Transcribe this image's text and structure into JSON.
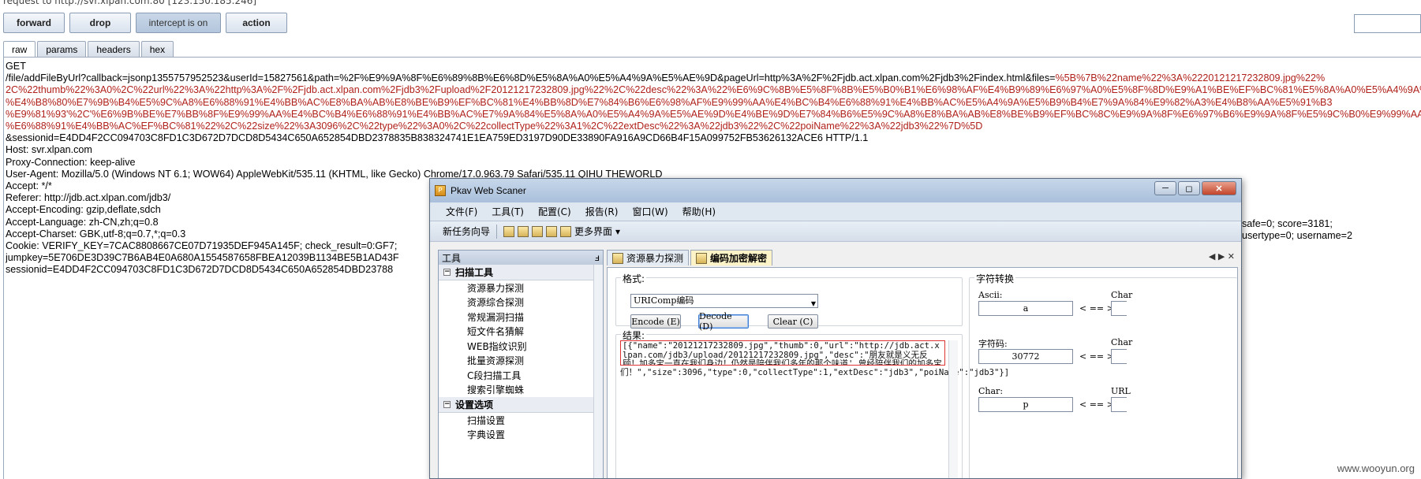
{
  "top_line": "request to http://svr.xlpan.com:80  [123.150.185.246]",
  "toolbar": {
    "forward": "forward",
    "drop": "drop",
    "intercept": "intercept is on",
    "action": "action"
  },
  "tabs": [
    "raw",
    "params",
    "headers",
    "hex"
  ],
  "request": {
    "lines": [
      {
        "text": "GET",
        "hl": ""
      },
      {
        "text": "/file/addFileByUrl?callback=jsonp1355757952523&userId=15827561&path=%2F%E9%9A%8F%E6%89%8B%E6%8D%E5%8A%A0%E5%A4%9A%E5%AE%9D&pageUrl=http%3A%2F%2Fjdb.act.xlpan.com%2Fjdb3%2Findex.html&files=",
        "hl": "%5B%7B%22name%22%3A%2220121217232809.jpg%22%"
      },
      {
        "text": "",
        "hl": "2C%22thumb%22%3A0%2C%22url%22%3A%22http%3A%2F%2Fjdb.act.xlpan.com%2Fjdb3%2Fupload%2F20121217232809.jpg%22%2C%22desc%22%3A%22%E6%9C%8B%E5%8F%8B%E5%B0%B1%E6%98%AF%E4%B9%89%E6%97%A0%E5%8F%8D%E9%A1%BE%EF%BC%81%E5%8A%A0%E5%A4%9A%E5%AE%9D"
      },
      {
        "text": "",
        "hl": "%E4%B8%80%E7%9B%B4%E5%9C%A8%E6%88%91%E4%BB%AC%E8%BA%AB%E8%BE%B9%EF%BC%81%E4%BB%8D%E7%84%B6%E6%98%AF%E9%99%AA%E4%BC%B4%E6%88%91%E4%BB%AC%E5%A4%9A%E5%B9%B4%E7%9A%84%E9%82%A3%E4%B8%AA%E5%91%B3"
      },
      {
        "text": "",
        "hl": "%E9%81%93'%2C'%E6%9B%BE%E7%BB%8F%E9%99%AA%E4%BC%B4%E6%88%91%E4%BB%AC%E7%9A%84%E5%8A%A0%E5%A4%9A%E5%AE%9D%E4%BE%9D%E7%84%B6%E5%9C%A8%E8%BA%AB%E8%BE%B9%EF%BC%8C%E9%9A%8F%E6%97%B6%E9%9A%8F%E5%9C%B0%E9%99%AA%E4%BC%B4"
      },
      {
        "text": "",
        "hl": "%E6%88%91%E4%BB%AC%EF%BC%81%22%2C%22size%22%3A3096%2C%22type%22%3A0%2C%22collectType%22%3A1%2C%22extDesc%22%3A%22jdb3%22%2C%22poiName%22%3A%22jdb3%22%7D%5D"
      },
      {
        "text": "&sessionid=E4DD4F2CC094703C8FD1C3D672D7DCD8D5434C650A652854DBD2378835B838324741E1EA759ED3197D90DE33890FA916A9CD66B4F15A099752FB53626132ACE6 HTTP/1.1",
        "hl": ""
      },
      {
        "text": "Host: svr.xlpan.com",
        "hl": ""
      },
      {
        "text": "Proxy-Connection: keep-alive",
        "hl": ""
      },
      {
        "text": "User-Agent: Mozilla/5.0 (Windows NT 6.1; WOW64) AppleWebKit/535.11 (KHTML, like Gecko) Chrome/17.0.963.79 Safari/535.11 QIHU THEWORLD",
        "hl": ""
      },
      {
        "text": "Accept: */*",
        "hl": ""
      },
      {
        "text": "Referer: http://jdb.act.xlpan.com/jdb3/",
        "hl": ""
      },
      {
        "text": "Accept-Encoding: gzip,deflate,sdch",
        "hl": ""
      },
      {
        "text": "Accept-Language: zh-CN,zh;q=0.8",
        "hl": ""
      },
      {
        "text": "Accept-Charset: GBK,utf-8;q=0.7,*;q=0.3",
        "hl": ""
      },
      {
        "text": "Cookie: VERIFY_KEY=7CAC8808667CE07D71935DEF945A145F; check_result=0:GF7;",
        "hl": ""
      },
      {
        "text": "jumpkey=5E706DE3D39C7B6AB4E0A680A1554587658FBEA12039B1134BE5B1AD43F",
        "hl": ""
      },
      {
        "text": "sessionid=E4DD4F2CC094703C8FD1C3D672D7DCD8D5434C650A652854DBD23788",
        "hl": ""
      }
    ],
    "right_frag_1": "safe=0; score=3181;",
    "right_frag_2": "usertype=0; username=2"
  },
  "window": {
    "title": "Pkav Web Scaner",
    "controls": {
      "minimize": "─",
      "restore": "◻",
      "close": "✕"
    },
    "menu": [
      "文件(F)",
      "工具(T)",
      "配置(C)",
      "报告(R)",
      "窗口(W)",
      "帮助(H)"
    ],
    "toolbar": {
      "new_task": "新任务向导",
      "more": "更多界面"
    },
    "left_pane": {
      "title": "工具",
      "pin": "ⅎ",
      "group1": "扫描工具",
      "group1_items": [
        "资源暴力探测",
        "资源综合探测",
        "常规漏洞扫描",
        "短文件名猜解",
        "WEB指纹识别",
        "批量资源探测",
        "C段扫描工具",
        "搜索引擎蜘蛛"
      ],
      "group2": "设置选项",
      "group2_items": [
        "扫描设置",
        "字典设置"
      ]
    },
    "doc_tabs": [
      "资源暴力探测",
      "编码加密解密"
    ],
    "tab_nav": "◀ ▶ ✕",
    "format_label": "格式:",
    "format_value": "URIComp编码",
    "buttons": {
      "encode": "Encode (E)",
      "decode": "Decode (D)",
      "clear": "Clear (C)"
    },
    "result_label": "结果:",
    "result_text": "[{\"name\":\"20121217232809.jpg\",\"thumb\":0,\"url\":\"http://jdb.act.xlpan.com/jdb3/upload/20121217232809.jpg\",\"desc\":\"朋友就是义无反顾！加多宝一直在我们身边！仍然是陪伴我们多年的那个味道',曾经陪伴我们的加多宝依然在身边，随时随地陪伴我",
    "result_text2": "们！\",\"size\":3096,\"type\":0,\"collectType\":1,\"extDesc\":\"jdb3\",\"poiName\":\"jdb3\"}]",
    "char_convert": {
      "title": "字符转换",
      "ascii_label": "Ascii:",
      "ascii_value": "a",
      "code_label": "字符码:",
      "code_value": "30772",
      "char_label": "Char:",
      "char_value": "p",
      "arrow": "< == >",
      "right_label1": "Char",
      "right_label2": "Char",
      "right_label3": "URL"
    }
  },
  "watermark": "www.wooyun.org"
}
